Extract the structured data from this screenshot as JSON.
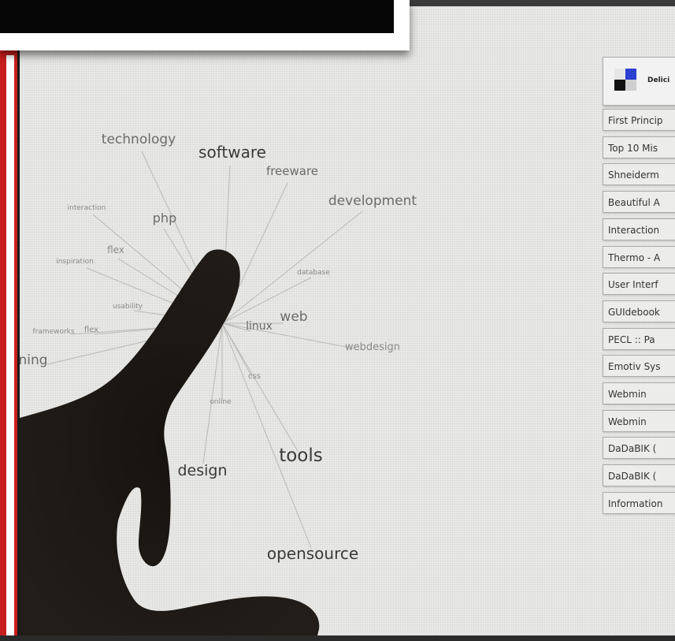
{
  "tag_cloud": {
    "center_tag": "",
    "tags": [
      {
        "id": "technology",
        "text": "technology",
        "size": 17
      },
      {
        "id": "software",
        "text": "software",
        "size": 20
      },
      {
        "id": "freeware",
        "text": "freeware",
        "size": 15
      },
      {
        "id": "development",
        "text": "development",
        "size": 17
      },
      {
        "id": "interaction",
        "text": "interaction",
        "size": 9
      },
      {
        "id": "php",
        "text": "php",
        "size": 16
      },
      {
        "id": "flex",
        "text": "flex",
        "size": 12
      },
      {
        "id": "inspiration",
        "text": "inspiration",
        "size": 9
      },
      {
        "id": "database",
        "text": "database",
        "size": 9
      },
      {
        "id": "usability",
        "text": "usability",
        "size": 9
      },
      {
        "id": "frameworks",
        "text": "frameworks",
        "size": 9
      },
      {
        "id": "flex2",
        "text": "flex",
        "size": 10
      },
      {
        "id": "linux",
        "text": "linux",
        "size": 14
      },
      {
        "id": "web",
        "text": "web",
        "size": 17
      },
      {
        "id": "webdesign",
        "text": "webdesign",
        "size": 13
      },
      {
        "id": "programming",
        "text": "ning",
        "size": 17
      },
      {
        "id": "css",
        "text": "css",
        "size": 10
      },
      {
        "id": "online",
        "text": "online",
        "size": 9
      },
      {
        "id": "tools",
        "text": "tools",
        "size": 23
      },
      {
        "id": "design",
        "text": "design",
        "size": 19
      },
      {
        "id": "opensource",
        "text": "opensource",
        "size": 20
      }
    ]
  },
  "bookmarks": {
    "logo_text": "Delici",
    "items": [
      "First Princip",
      "Top 10 Mis",
      "Shneiderm",
      "Beautiful A",
      "Interaction",
      "Thermo - A",
      "User Interf",
      "GUIdebook",
      "PECL :: Pa",
      "Emotiv Sys",
      "Webmin",
      "Webmin",
      "DaDaBIK (",
      "DaDaBIK (",
      "Information"
    ]
  },
  "colors": {
    "screen_bg": "#e9e9e7",
    "frame_red": "#c81e1e",
    "logo_blue": "#2b3fd0",
    "logo_black": "#111111",
    "logo_gray": "#bfbfbf"
  }
}
